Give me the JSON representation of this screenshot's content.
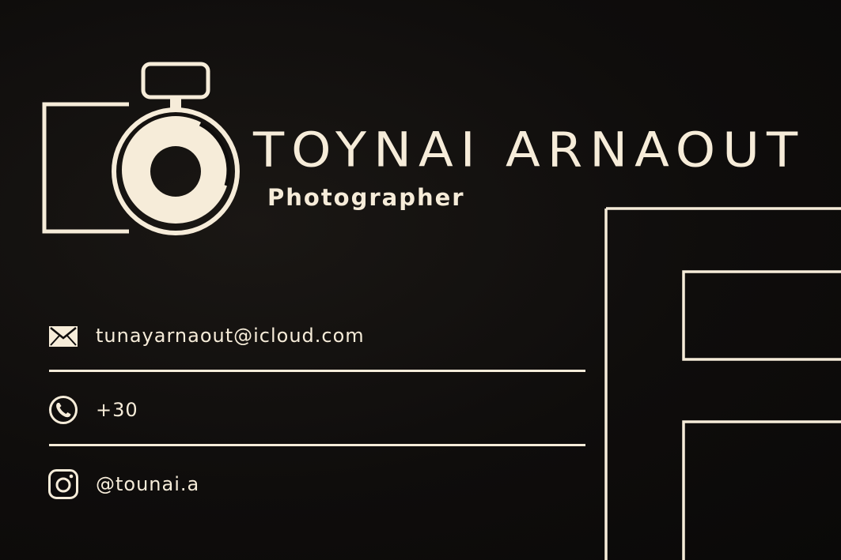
{
  "card": {
    "name": "TOYNAI ARNAOUT",
    "title": "Photographer",
    "contacts": [
      {
        "icon": "envelope-icon",
        "text": "tunayarnaout@icloud.com"
      },
      {
        "icon": "phone-icon",
        "text": "+30"
      },
      {
        "icon": "instagram-icon",
        "text": "@tounai.a"
      }
    ],
    "logo_icon": "camera-logo-icon",
    "decor_letter_icon": "outlined-letter-f"
  },
  "colors": {
    "background": "#0d0b0a",
    "accent": "#f6ecd9"
  }
}
